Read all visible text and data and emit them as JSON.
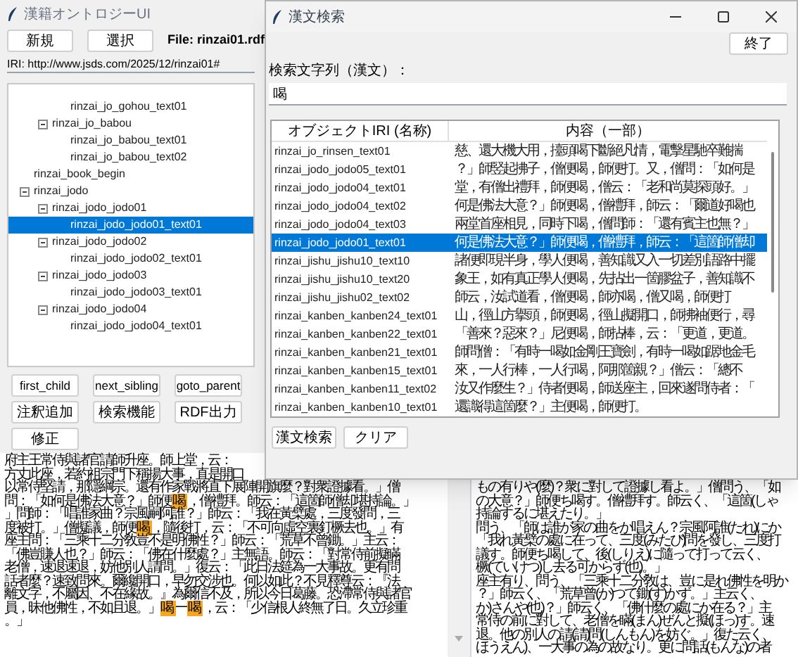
{
  "main_window": {
    "title": "漢籍オントロジーUI",
    "top_buttons": [
      "新規",
      "選択"
    ],
    "file_label": "File: rinzai01.rdf",
    "iri": "IRI: http://www.jsds.com/2025/12/rinzai01#",
    "tree": {
      "items": [
        {
          "children": [
            {
              "children": [
                {
                  "label": "rinzai_jo_gohou_text01",
                  "selected": false
                }
              ]
            },
            {
              "label": "rinzai_jo_babou",
              "expanded": true,
              "selected": false,
              "children": [
                {
                  "label": "rinzai_jo_babou_text01",
                  "selected": false
                },
                {
                  "label": "rinzai_jo_babou_text02",
                  "selected": false
                }
              ]
            }
          ]
        },
        {
          "label": "rinzai_book_begin",
          "selected": false
        },
        {
          "label": "rinzai_jodo",
          "expanded": true,
          "selected": false,
          "children": [
            {
              "label": "rinzai_jodo_jodo01",
              "expanded": true,
              "selected": false,
              "children": [
                {
                  "label": "rinzai_jodo_jodo01_text01",
                  "selected": true
                }
              ]
            },
            {
              "label": "rinzai_jodo_jodo02",
              "expanded": true,
              "selected": false,
              "children": [
                {
                  "label": "rinzai_jodo_jodo02_text01",
                  "selected": false
                }
              ]
            },
            {
              "label": "rinzai_jodo_jodo03",
              "expanded": true,
              "selected": false,
              "children": [
                {
                  "label": "rinzai_jodo_jodo03_text01",
                  "selected": false
                }
              ]
            },
            {
              "label": "rinzai_jodo_jodo04",
              "expanded": true,
              "selected": false,
              "children": [
                {
                  "label": "rinzai_jodo_jodo04_text01",
                  "selected": false
                }
              ]
            }
          ]
        }
      ]
    },
    "button_rows": [
      [
        "first_child",
        "next_sibling",
        "goto_parent"
      ],
      [
        "注釈追加",
        "検索機能",
        "RDF出力"
      ],
      [
        "修正"
      ]
    ],
    "kanbun_text": {
      "lines": [
        [
          {
            "text": "府主王常侍與諸官請師升座。師上堂，云：",
            "highlighted": false
          }
        ],
        [
          {
            "text": "方丈此座，若約祖宗門下稱揚大事，直是開口",
            "highlighted": false
          }
        ],
        [
          {
            "text": "以常侍堅請，那隱綱宗。還有作家戰將直下展陣開旗麼？對衆證據看。」僧",
            "highlighted": false
          }
        ],
        [
          {
            "text": "問：「如何是佛法大意？」師便",
            "highlighted": false
          },
          {
            "text": "喝",
            "highlighted": true
          },
          {
            "text": "，僧禮拜。師云：「這箇師僧却堪持論。」",
            "highlighted": false
          }
        ],
        [
          {
            "text": "」問師：「唱誰家曲？宗風嗣阿誰？」師云：「我在黃檗處，三度發問，三",
            "highlighted": false
          }
        ],
        [
          {
            "text": "度被打。」僧擬議，師便",
            "highlighted": false
          },
          {
            "text": "喝",
            "highlighted": true
          },
          {
            "text": "，隨後打，云：「不可向虛空裏釘橛去也。」有",
            "highlighted": false
          }
        ],
        [
          {
            "text": "座主問：「三乘十二分敎豈不是明佛性？」師云：「荒草不曾鋤。」主云：",
            "highlighted": false
          }
        ],
        [
          {
            "text": "「佛豈賺人也？」師云：「佛在什麼處？」主無語。師云：「對常侍前擬瞞",
            "highlighted": false
          }
        ],
        [
          {
            "text": "老僧，速退速退，妨他別人請問。」復云：「此日法筵為一大事故。更有問",
            "highlighted": false
          }
        ],
        [
          {
            "text": "話者麼？速致問來。爾纔開口，早勿交涉也。何以如此？不見釋尊云：『法",
            "highlighted": false
          }
        ],
        [
          {
            "text": "離文字，不屬因、不在緣故。』為爾信不及，所以今日葛藤。恐滯常侍與諸官",
            "highlighted": false
          }
        ],
        [
          {
            "text": "員，昧他佛性，不如且退。」",
            "highlighted": false
          },
          {
            "text": "喝",
            "highlighted": true
          },
          {
            "text": "一",
            "highlighted": false
          },
          {
            "text": "喝",
            "highlighted": true
          },
          {
            "text": "，云：「少信根人終無了日。久立珍重",
            "highlighted": false
          }
        ],
        [
          {
            "text": "。」",
            "highlighted": false
          }
        ]
      ]
    },
    "kundoku_text": {
      "lines": [
        "もの有りや(麼)？衆に對して證據し看よ。」僧問う、「如",
        "の大意？」師便ち喝す。僧禮拜す。師云く、「這箇(しゃ",
        "持論するに堪えたり。」",
        "問う、「師は誰が家の曲をか唱えん？宗風阿誰(たれ)にか",
        "「我れ黃檗の處に在って、三度(みたび)問を發し、三度打",
        "議す。師便ち喝して、後(しりえ)に隨って打って云く、",
        "橛(ていけつ)し去る可からず(也)。」",
        "座主有り、問う、「三乘十二分敎は、豈に是れ佛性を明か",
        "？」師云く、「荒草曾(か)つて鋤(す)かず。」主云く、",
        "か)さんや(也)？」師云く、「佛什麼の處にか在る？」主",
        "常侍の前に對して、老僧を瞞(まん)ぜんと擬(ほっ)す。速",
        "退。他の別人の請(請)問(しんもん)を妨ぐ。」復た云く、",
        "ほうえん)、一大事の為の故なり。更に問話(もんな)の者"
      ]
    }
  },
  "search_dialog": {
    "title": "漢文検索",
    "close_button": "終了",
    "search_label": "検索文字列（漢文）：",
    "search_value": "喝",
    "table": {
      "columns": [
        "オブジェクトIRI (名称)",
        "内容（一部）"
      ],
      "rows": [
        {
          "cells": [
            "rinzai_jo_rinsen_text01",
            "慈、還大機大用，擡頭喝下斷絕凡情，電擊星馳卒難揣"
          ],
          "selected": false
        },
        {
          "cells": [
            "rinzai_jodo_jodo05_text01",
            "？」師竪起拂子，僧便喝，師便打。又，僧問：「如何是"
          ],
          "selected": false
        },
        {
          "cells": [
            "rinzai_jodo_jodo04_text01",
            "堂，有僧出禮拜，師便喝，僧云：「老和尚莫探頭好。」"
          ],
          "selected": false
        },
        {
          "cells": [
            "rinzai_jodo_jodo04_text02",
            "何是佛法大意？」師便喝，僧禮拜，師云：「爾道好喝也"
          ],
          "selected": false
        },
        {
          "cells": [
            "rinzai_jodo_jodo04_text03",
            "兩堂首座相見，同時下喝，僧問師：「還有賓主也無？」"
          ],
          "selected": false
        },
        {
          "cells": [
            "rinzai_jodo_jodo01_text01",
            "何是佛法大意？」師便喝，僧禮拜，師云：「這箇師僧却"
          ],
          "selected": true
        },
        {
          "cells": [
            "rinzai_jishu_jishu10_text10",
            "諸便即現半身，學人便喝，善知識又入一切差別語路中擺"
          ],
          "selected": false
        },
        {
          "cells": [
            "rinzai_jishu_jishu10_text20",
            "象王，如有真正學人便喝，先拈出一箇膠盆子，善知識不"
          ],
          "selected": false
        },
        {
          "cells": [
            "rinzai_jishu_jishu02_text02",
            "師云，汝試道看，僧便喝，師亦喝，僧又喝，師便打"
          ],
          "selected": false
        },
        {
          "cells": [
            "rinzai_kanben_kanben24_text01",
            "山，徑山方擧頭，師便喝，徑山擬開口，師拂袖便行，尋"
          ],
          "selected": false
        },
        {
          "cells": [
            "rinzai_kanben_kanben22_text01",
            "「善來？惡來？」尼便喝，師拈棒，云：「更道，更道。"
          ],
          "selected": false
        },
        {
          "cells": [
            "rinzai_kanben_kanben21_text01",
            "師問僧：「有時一喝如金剛王寶劍，有時一喝如踞地金毛"
          ],
          "selected": false
        },
        {
          "cells": [
            "rinzai_kanben_kanben15_text01",
            "來，一人行棒，一人行喝，阿那箇親？」僧云：「總不"
          ],
          "selected": false
        },
        {
          "cells": [
            "rinzai_kanben_kanben11_text02",
            "汝又作麼生？」侍者便喝，師送座主，回來遂問侍者：「"
          ],
          "selected": false
        },
        {
          "cells": [
            "rinzai_kanben_kanben10_text01",
            "還識得這箇麼？」主便喝，師便打。"
          ],
          "selected": false
        }
      ]
    },
    "buttons": [
      "漢文検索",
      "クリア"
    ]
  }
}
